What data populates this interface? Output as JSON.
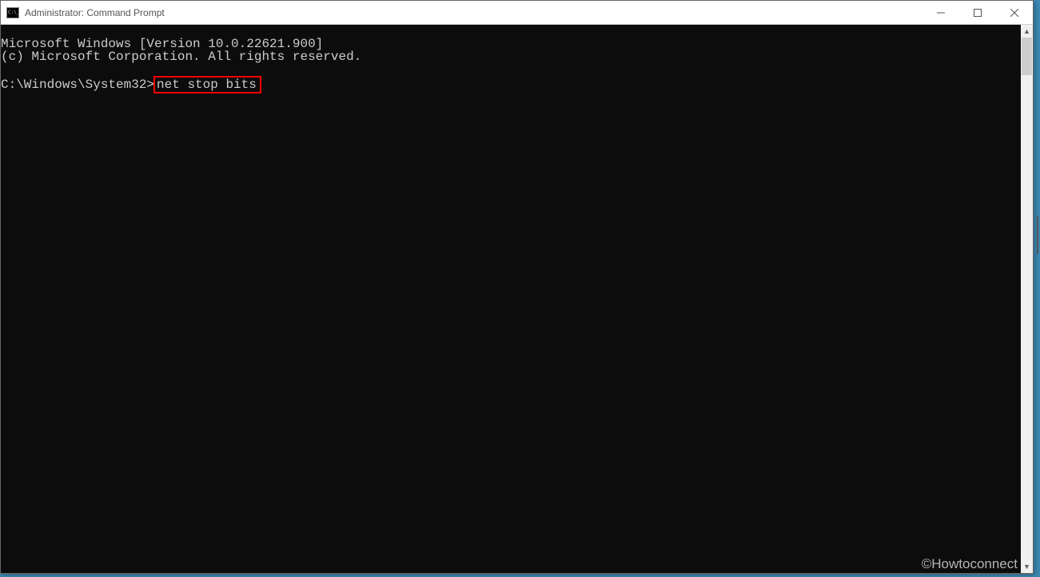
{
  "titlebar": {
    "title": "Administrator: Command Prompt"
  },
  "console": {
    "line1": "Microsoft Windows [Version 10.0.22621.900]",
    "line2": "(c) Microsoft Corporation. All rights reserved.",
    "blank": "",
    "prompt": "C:\\Windows\\System32>",
    "command": "net stop bits"
  },
  "watermark": "©Howtoconnect"
}
